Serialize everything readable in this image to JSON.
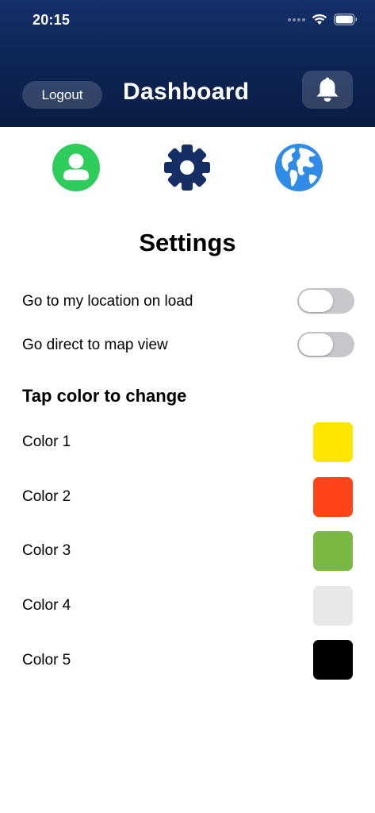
{
  "status_bar": {
    "time": "20:15"
  },
  "header": {
    "title": "Dashboard",
    "logout_label": "Logout",
    "background_color": "#0d2452"
  },
  "nav_icons": [
    {
      "name": "profile-icon",
      "color": "#2ecc5a"
    },
    {
      "name": "gear-icon",
      "color": "#152e63"
    },
    {
      "name": "globe-icon",
      "color": "#2f8be6"
    }
  ],
  "settings": {
    "title": "Settings",
    "toggles": [
      {
        "label": "Go to my location on load",
        "on": false
      },
      {
        "label": "Go direct to map view",
        "on": false
      }
    ]
  },
  "colors_section": {
    "title": "Tap color to change",
    "items": [
      {
        "label": "Color 1",
        "color": "#ffe600"
      },
      {
        "label": "Color 2",
        "color": "#ff4419"
      },
      {
        "label": "Color 3",
        "color": "#78b843"
      },
      {
        "label": "Color 4",
        "color": "#e8e8e8"
      },
      {
        "label": "Color 5",
        "color": "#000000"
      }
    ]
  }
}
